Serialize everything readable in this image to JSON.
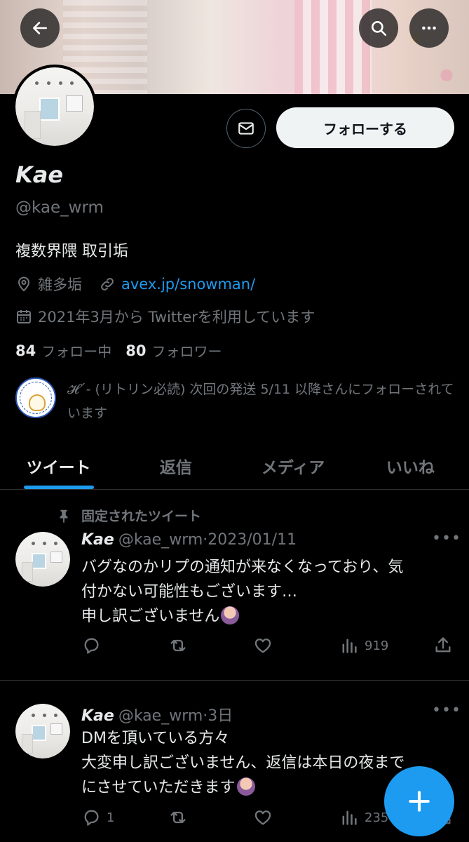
{
  "header": {
    "back_icon": "back-arrow-icon",
    "search_icon": "search-icon",
    "more_icon": "more-icon"
  },
  "profile": {
    "name": "Kae",
    "handle": "@kae_wrm",
    "bio": "複数界隈 取引垢",
    "location": "雑多垢",
    "website": "avex.jp/snowman/",
    "joined": "2021年3月から Twitterを利用しています",
    "following_count": "84",
    "following_label": "フォロー中",
    "followers_count": "80",
    "followers_label": "フォロワー",
    "followed_by": "𝓗´- (リトリン必読) 次回の発送 5/11 以降さんにフォローされています"
  },
  "actions": {
    "follow_label": "フォローする",
    "message_icon": "mail-icon"
  },
  "tabs": [
    {
      "label": "ツイート",
      "active": true
    },
    {
      "label": "返信",
      "active": false
    },
    {
      "label": "メディア",
      "active": false
    },
    {
      "label": "いいね",
      "active": false
    }
  ],
  "pinned_label": "固定されたツイート",
  "tweets": [
    {
      "name": "Kae",
      "handle": "@kae_wrm",
      "date": "2023/01/11",
      "lines": [
        "バグなのかリプの通知が来なくなっており、気",
        "付かない可能性もございます…",
        "申し訳ございません"
      ],
      "reply_count": "",
      "views": "919"
    },
    {
      "name": "Kae",
      "handle": "@kae_wrm",
      "date": "3日",
      "lines": [
        "DMを頂いている方々",
        "大変申し訳ございません、返信は本日の夜まで",
        "にさせていただきます"
      ],
      "reply_count": "1",
      "views": "235"
    }
  ],
  "colors": {
    "accent": "#1d9bf0",
    "background": "#000000",
    "secondary_text": "#71767b"
  }
}
